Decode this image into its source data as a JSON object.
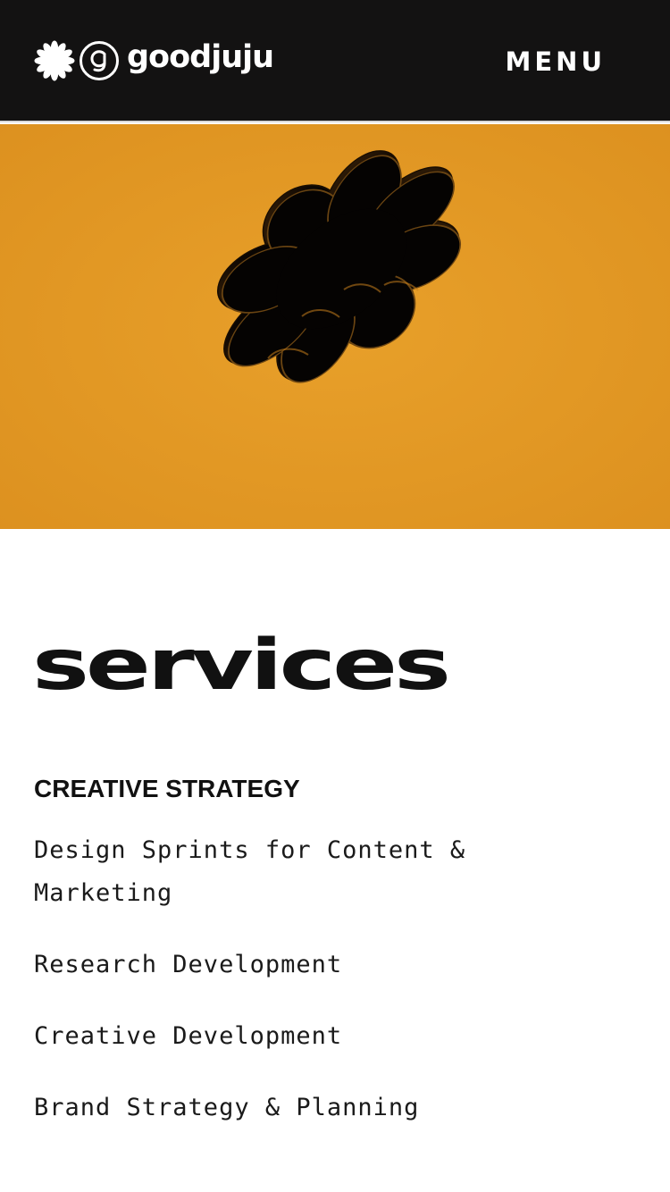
{
  "header": {
    "brand_name": "goodjuju",
    "menu_label": "MENU"
  },
  "colors": {
    "header_bg": "#131212",
    "hero_bg": "#e09521",
    "text": "#111111"
  },
  "hero": {
    "image": "3d-black-flower-icon"
  },
  "services": {
    "title": "services",
    "category": "CREATIVE STRATEGY",
    "items": [
      "Design Sprints for Content & Marketing",
      "Research Development",
      "Creative Development",
      "Brand Strategy & Planning"
    ]
  }
}
